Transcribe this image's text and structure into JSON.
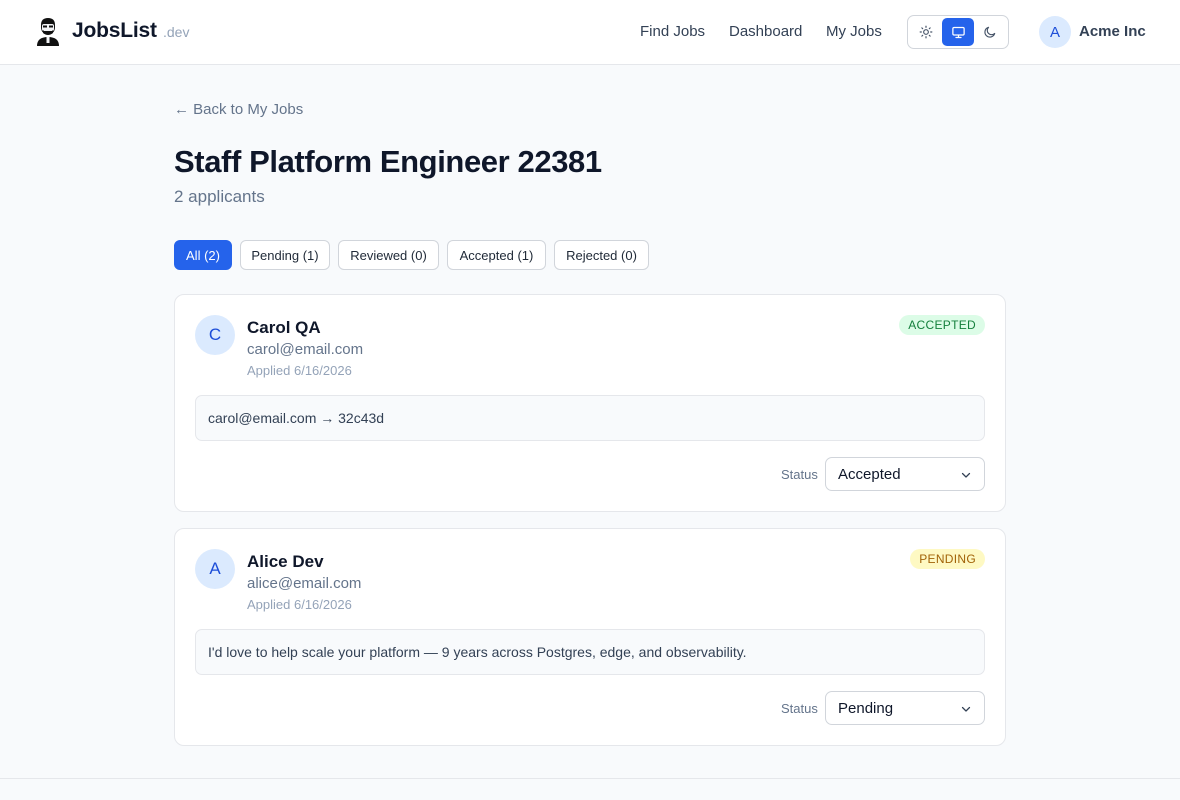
{
  "header": {
    "brand": "JobsList",
    "brand_suffix": ".dev",
    "nav": [
      "Find Jobs",
      "Dashboard",
      "My Jobs"
    ],
    "theme_options": [
      "sun-icon",
      "monitor-icon",
      "moon-icon"
    ],
    "theme_selected": "monitor-icon",
    "user_initial": "A",
    "company": "Acme Inc"
  },
  "main": {
    "back_link": "← Back to My Jobs",
    "title": "Staff Platform Engineer 22381",
    "subtitle": "2 applicants",
    "filters": [
      "All (2)",
      "Pending (1)",
      "Reviewed (0)",
      "Accepted (1)",
      "Rejected (0)"
    ],
    "filter_selected": "All (2)",
    "status_label": "Status",
    "applicants": [
      {
        "initial": "C",
        "name": "Carol QA",
        "email": "carol@email.com",
        "applied": "Applied 6/16/2026",
        "badge": "ACCEPTED",
        "message": "carol@email.com → 32c43d",
        "status": "Accepted"
      },
      {
        "initial": "A",
        "name": "Alice Dev",
        "email": "alice@email.com",
        "applied": "Applied 6/16/2026",
        "badge": "PENDING",
        "message": "I'd love to help scale your platform — 9 years across Postgres, edge, and observability.",
        "status": "Pending"
      }
    ]
  },
  "colors": {
    "accent": "#2563eb",
    "accepted_bg": "#dcfce7",
    "accepted_text": "#15803d",
    "pending_bg": "#fef9c3",
    "pending_text": "#a16207"
  }
}
